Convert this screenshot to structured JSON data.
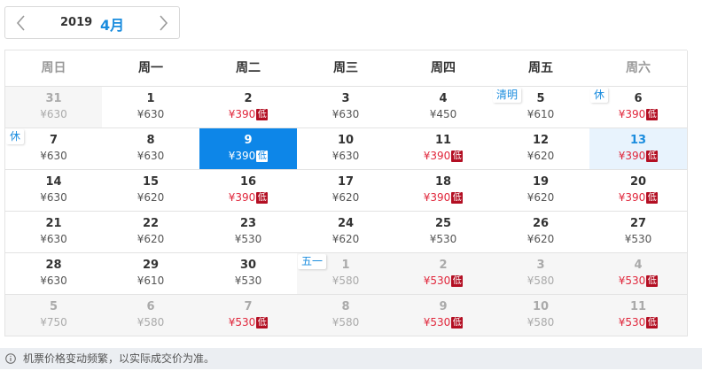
{
  "nav": {
    "year": "2019",
    "month": "4月",
    "prev_icon": "chevron-left-icon",
    "next_icon": "chevron-right-icon"
  },
  "weekdays": [
    "周日",
    "周一",
    "周二",
    "周三",
    "周四",
    "周五",
    "周六"
  ],
  "low_badge_label": "低",
  "weeks": [
    [
      {
        "num": "31",
        "price": "¥630",
        "low": false,
        "other": true
      },
      {
        "num": "1",
        "price": "¥630",
        "low": false
      },
      {
        "num": "2",
        "price": "¥390",
        "low": true
      },
      {
        "num": "3",
        "price": "¥630",
        "low": false
      },
      {
        "num": "4",
        "price": "¥450",
        "low": false
      },
      {
        "num": "5",
        "price": "¥610",
        "low": false,
        "tag": "清明"
      },
      {
        "num": "6",
        "price": "¥390",
        "low": true,
        "tag": "休"
      }
    ],
    [
      {
        "num": "7",
        "price": "¥630",
        "low": false,
        "tag": "休"
      },
      {
        "num": "8",
        "price": "¥630",
        "low": false
      },
      {
        "num": "9",
        "price": "¥390",
        "low": true,
        "selected": true
      },
      {
        "num": "10",
        "price": "¥630",
        "low": false
      },
      {
        "num": "11",
        "price": "¥390",
        "low": true
      },
      {
        "num": "12",
        "price": "¥620",
        "low": false
      },
      {
        "num": "13",
        "price": "¥390",
        "low": true,
        "today": true
      }
    ],
    [
      {
        "num": "14",
        "price": "¥630",
        "low": false
      },
      {
        "num": "15",
        "price": "¥620",
        "low": false
      },
      {
        "num": "16",
        "price": "¥390",
        "low": true
      },
      {
        "num": "17",
        "price": "¥620",
        "low": false
      },
      {
        "num": "18",
        "price": "¥390",
        "low": true
      },
      {
        "num": "19",
        "price": "¥620",
        "low": false
      },
      {
        "num": "20",
        "price": "¥390",
        "low": true
      }
    ],
    [
      {
        "num": "21",
        "price": "¥630",
        "low": false
      },
      {
        "num": "22",
        "price": "¥620",
        "low": false
      },
      {
        "num": "23",
        "price": "¥530",
        "low": false
      },
      {
        "num": "24",
        "price": "¥620",
        "low": false
      },
      {
        "num": "25",
        "price": "¥530",
        "low": false
      },
      {
        "num": "26",
        "price": "¥620",
        "low": false
      },
      {
        "num": "27",
        "price": "¥530",
        "low": false
      }
    ],
    [
      {
        "num": "28",
        "price": "¥630",
        "low": false
      },
      {
        "num": "29",
        "price": "¥610",
        "low": false
      },
      {
        "num": "30",
        "price": "¥530",
        "low": false
      },
      {
        "num": "1",
        "price": "¥580",
        "low": false,
        "other": true,
        "tag": "五一"
      },
      {
        "num": "2",
        "price": "¥530",
        "low": true,
        "other": true
      },
      {
        "num": "3",
        "price": "¥580",
        "low": false,
        "other": true
      },
      {
        "num": "4",
        "price": "¥530",
        "low": true,
        "other": true
      }
    ],
    [
      {
        "num": "5",
        "price": "¥750",
        "low": false,
        "other": true
      },
      {
        "num": "6",
        "price": "¥580",
        "low": false,
        "other": true
      },
      {
        "num": "7",
        "price": "¥530",
        "low": true,
        "other": true
      },
      {
        "num": "8",
        "price": "¥580",
        "low": false,
        "other": true
      },
      {
        "num": "9",
        "price": "¥530",
        "low": true,
        "other": true
      },
      {
        "num": "10",
        "price": "¥580",
        "low": false,
        "other": true
      },
      {
        "num": "11",
        "price": "¥530",
        "low": true,
        "other": true
      }
    ]
  ],
  "footer": {
    "icon": "info-icon",
    "text": "机票价格变动频繁，以实际成交价为准。"
  },
  "colors": {
    "accent": "#1a8cde",
    "selected_bg": "#0d86e8",
    "low_price": "#e0263b",
    "low_badge_bg": "#b30f23",
    "other_month_bg": "#f6f6f6",
    "today_bg": "#e8f3fd"
  }
}
